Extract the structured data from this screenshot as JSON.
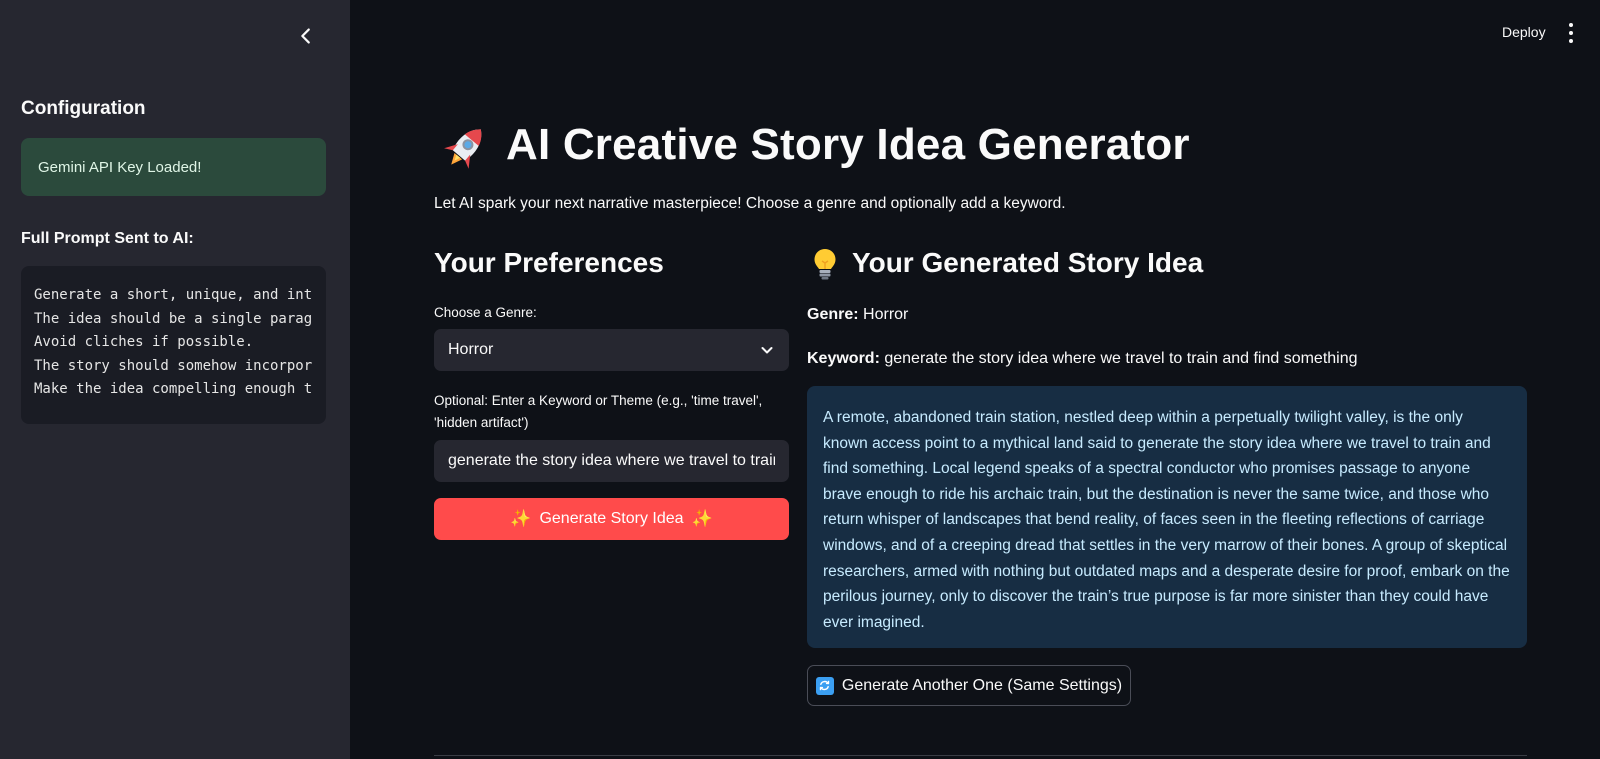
{
  "sidebar": {
    "collapse_icon": "chevron-left-icon",
    "title": "Configuration",
    "status_message": "Gemini API Key Loaded!",
    "status_color": "#2b4a3c",
    "prompt_heading": "Full Prompt Sent to AI:",
    "prompt_lines": [
      "Generate a short, unique, and int",
      "The idea should be a single parag",
      "Avoid cliches if possible.",
      "The story should somehow incorpor",
      "Make the idea compelling enough t"
    ]
  },
  "header": {
    "deploy_label": "Deploy",
    "menu_icon": "kebab-menu-icon"
  },
  "main": {
    "title_icon": "rocket-icon",
    "title": "AI Creative Story Idea Generator",
    "subtitle": "Let AI spark your next narrative masterpiece! Choose a genre and optionally add a keyword.",
    "preferences": {
      "heading": "Your Preferences",
      "genre_label": "Choose a Genre:",
      "genre_value": "Horror",
      "keyword_label": "Optional: Enter a Keyword or Theme (e.g., 'time travel', 'hidden artifact')",
      "keyword_value": "generate the story idea where we travel to train and find something",
      "generate_button": {
        "icon_left": "✨",
        "label": "Generate Story Idea",
        "icon_right": "✨",
        "color": "#ff4b4b"
      }
    },
    "result": {
      "heading_icon": "lightbulb-icon",
      "heading": "Your Generated Story Idea",
      "genre_key": "Genre:",
      "genre_value": "Horror",
      "keyword_key": "Keyword:",
      "keyword_value": "generate the story idea where we travel to train and find something",
      "story": "A remote, abandoned train station, nestled deep within a perpetually twilight valley, is the only known access point to a mythical land said to generate the story idea where we travel to train and find something. Local legend speaks of a spectral conductor who promises passage to anyone brave enough to ride his archaic train, but the destination is never the same twice, and those who return whisper of landscapes that bend reality, of faces seen in the fleeting reflections of carriage windows, and of a creeping dread that settles in the very marrow of their bones. A group of skeptical researchers, armed with nothing but outdated maps and a desperate desire for proof, embark on the perilous journey, only to discover the train’s true purpose is far more sinister than they could have ever imagined.",
      "story_bg": "#172d43",
      "again_button": {
        "icon": "refresh-icon",
        "label": "Generate Another One (Same Settings)"
      }
    }
  }
}
